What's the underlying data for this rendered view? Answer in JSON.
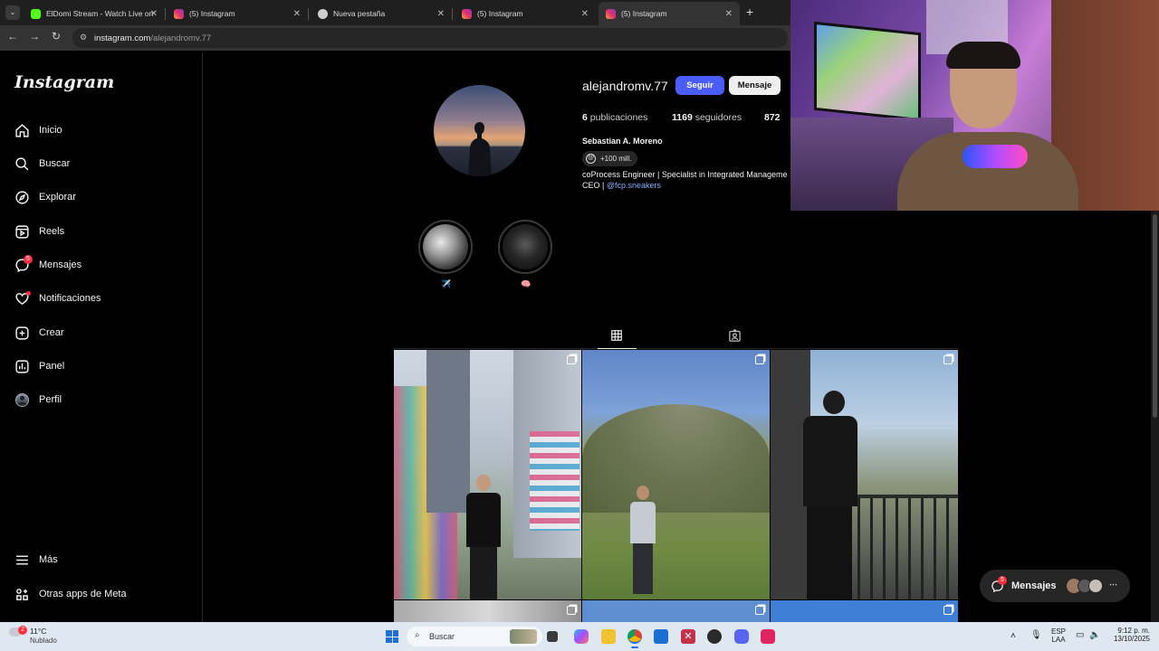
{
  "browser": {
    "tabs": [
      {
        "title": "ElDomi Stream - Watch Live on",
        "icon": "kick-icon",
        "color": "#53fc18",
        "active": false
      },
      {
        "title": "(5) Instagram",
        "icon": "instagram-icon",
        "color": "#e1306c",
        "active": false
      },
      {
        "title": "Nueva pestaña",
        "icon": "chrome-icon",
        "color": "#cfcfcf",
        "active": false
      },
      {
        "title": "(5) Instagram",
        "icon": "instagram-icon",
        "color": "#e1306c",
        "active": false
      },
      {
        "title": "(5) Instagram",
        "icon": "instagram-icon",
        "color": "#e1306c",
        "active": true
      }
    ],
    "new_tab": "+",
    "url_host": "instagram.com",
    "url_path": "/alejandromv.77"
  },
  "sidebar": {
    "logo": "Instagram",
    "items": [
      {
        "label": "Inicio",
        "icon": "home-icon"
      },
      {
        "label": "Buscar",
        "icon": "search-icon"
      },
      {
        "label": "Explorar",
        "icon": "compass-icon"
      },
      {
        "label": "Reels",
        "icon": "reels-icon"
      },
      {
        "label": "Mensajes",
        "icon": "messenger-icon",
        "badge": "5"
      },
      {
        "label": "Notificaciones",
        "icon": "heart-icon"
      },
      {
        "label": "Crear",
        "icon": "plus-square-icon"
      },
      {
        "label": "Panel",
        "icon": "chart-icon"
      },
      {
        "label": "Perfil",
        "icon": "avatar-icon"
      }
    ],
    "more": "Más",
    "meta_apps": "Otras apps de Meta"
  },
  "profile": {
    "username": "alejandromv.77",
    "follow_label": "Seguir",
    "message_label": "Mensaje",
    "posts_count": "6",
    "posts_label": "publicaciones",
    "followers_count": "1169",
    "followers_label": "seguidores",
    "following_count": "872",
    "full_name": "Sebastian A. Moreno",
    "threads_chip": "+100 mill.",
    "bio_line1": "coProcess Engineer | Specialist in Integrated Manageme",
    "bio_line2_prefix": "CEO | ",
    "bio_link": "@fcp.sneakers",
    "highlights": [
      {
        "emoji": "✈️"
      },
      {
        "emoji": "🧠"
      }
    ]
  },
  "floating_messages": {
    "label": "Mensajes",
    "badge": "5"
  },
  "taskbar": {
    "weather_temp": "11°C",
    "weather_desc": "Nublado",
    "weather_badge": "2",
    "search_placeholder": "Buscar",
    "lang_top": "ESP",
    "lang_bottom": "LAA",
    "time": "9:12 p. m.",
    "date": "13/10/2025",
    "colors": {
      "accent_blue": "#4a5df9",
      "badge_red": "#ff3040",
      "link": "#8ab0ff"
    }
  }
}
